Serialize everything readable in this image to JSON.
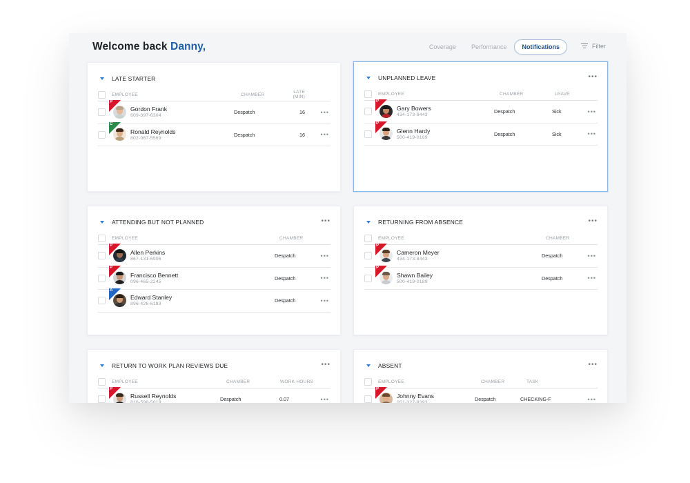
{
  "header": {
    "welcome_text": "Welcome back",
    "user_name": "Danny,",
    "tabs": [
      {
        "label": "Coverage",
        "active": false
      },
      {
        "label": "Performance",
        "active": false
      },
      {
        "label": "Notifications",
        "active": true
      }
    ],
    "filter_label": "Filter"
  },
  "colors": {
    "accent": "#1f5fa8",
    "flag_p": "#d7182a",
    "flag_c": "#2c8a4b",
    "flag_a": "#2466c4",
    "selected_border": "#8cb8e6"
  },
  "cards": {
    "late_starter": {
      "title": "LATE STARTER",
      "columns": [
        "EMPLOYEE",
        "CHAMBER",
        "LATE (MIN)"
      ],
      "rows": [
        {
          "flag": "P",
          "name": "Gordon Frank",
          "phone": "609-397-6304",
          "chamber": "Despatch",
          "value": "16"
        },
        {
          "flag": "C",
          "name": "Ronald Reynolds",
          "phone": "802-067-5569",
          "chamber": "Despatch",
          "value": "16"
        }
      ]
    },
    "unplanned_leave": {
      "title": "UNPLANNED LEAVE",
      "columns": [
        "EMPLOYEE",
        "CHAMBER",
        "LEAVE"
      ],
      "rows": [
        {
          "flag": "P",
          "name": "Gary Bowers",
          "phone": "434-173-8443",
          "chamber": "Despatch",
          "value": "Sick"
        },
        {
          "flag": "P",
          "name": "Glenn Hardy",
          "phone": "500-419-0189",
          "chamber": "Despatch",
          "value": "Sick"
        }
      ]
    },
    "attending_not_planned": {
      "title": "ATTENDING BUT NOT PLANNED",
      "columns": [
        "EMPLOYEE",
        "CHAMBER"
      ],
      "rows": [
        {
          "flag": "P",
          "name": "Allen Perkins",
          "phone": "867-131-6906",
          "chamber": "Despatch"
        },
        {
          "flag": "P",
          "name": "Francisco Bennett",
          "phone": "096-465-2245",
          "chamber": "Despatch"
        },
        {
          "flag": "A",
          "name": "Edward Stanley",
          "phone": "896-426-6183",
          "chamber": "Despatch"
        }
      ]
    },
    "returning_from_absence": {
      "title": "RETURNING FROM ABSENCE",
      "columns": [
        "EMPLOYEE",
        "CHAMBER"
      ],
      "rows": [
        {
          "flag": "P",
          "name": "Cameron Meyer",
          "phone": "434-173-8443",
          "chamber": "Despatch"
        },
        {
          "flag": "P",
          "name": "Shawn Bailey",
          "phone": "500-419-0189",
          "chamber": "Despatch"
        }
      ]
    },
    "return_to_work": {
      "title": "RETURN TO WORK PLAN REVIEWS DUE",
      "columns": [
        "EMPLOYEE",
        "CHAMBER",
        "WORK HOURS"
      ],
      "rows": [
        {
          "flag": "P",
          "name": "Russell Reynolds",
          "phone": "816-598-5019",
          "chamber": "Despatch",
          "value": "0.07"
        }
      ]
    },
    "absent": {
      "title": "ABSENT",
      "columns": [
        "EMPLOYEE",
        "CHAMBER",
        "TASK"
      ],
      "rows": [
        {
          "flag": "P",
          "name": "Johnny Evans",
          "phone": "051-327-9393",
          "chamber": "Despatch",
          "value": "CHECKING-F"
        }
      ]
    }
  }
}
